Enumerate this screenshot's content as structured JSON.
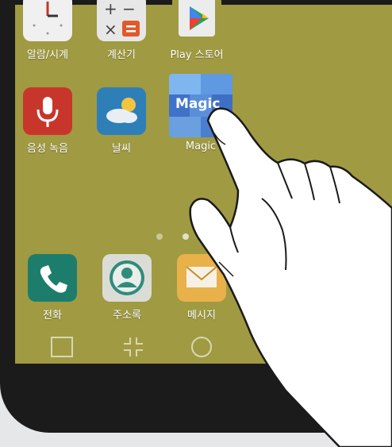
{
  "home": {
    "row1": [
      {
        "label": "알람/시계",
        "icon": "clock-icon"
      },
      {
        "label": "계산기",
        "icon": "calculator-icon"
      },
      {
        "label": "Play 스토어",
        "icon": "play-store-icon"
      }
    ],
    "row2": [
      {
        "label": "음성 녹음",
        "icon": "microphone-icon"
      },
      {
        "label": "날씨",
        "icon": "weather-icon"
      },
      {
        "label": "Magic",
        "icon": "magic-icon",
        "icon_text": "Magic"
      }
    ],
    "dock": [
      {
        "label": "전화",
        "icon": "phone-icon"
      },
      {
        "label": "주소록",
        "icon": "contacts-icon"
      },
      {
        "label": "메시지",
        "icon": "message-icon"
      }
    ],
    "page_indicator": {
      "count": 3,
      "active": 2
    }
  },
  "navigation": {
    "buttons": [
      "recent-apps",
      "switch",
      "home"
    ]
  },
  "colors": {
    "wallpaper": "#a09a42",
    "bezel": "#1b1b1b",
    "background": "#e6e7e9"
  }
}
